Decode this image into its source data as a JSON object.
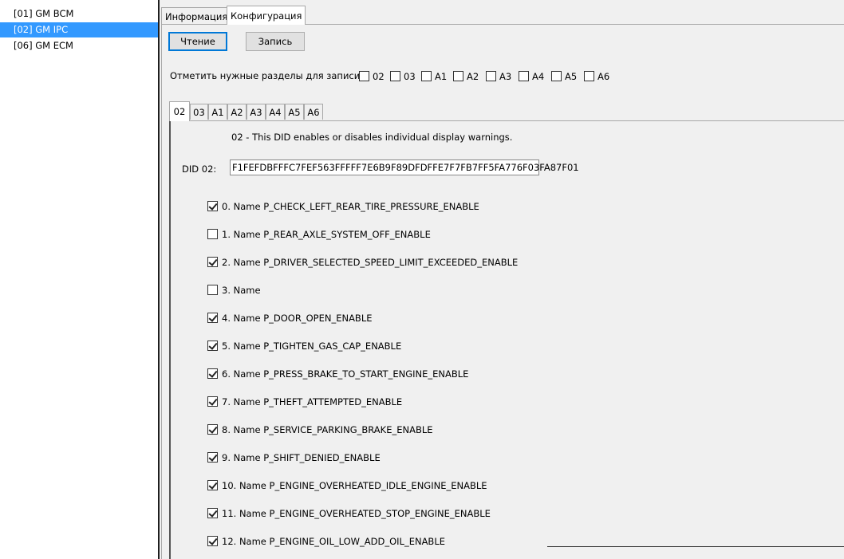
{
  "devices": [
    {
      "label": "[01] GM BCM",
      "selected": false
    },
    {
      "label": "[02] GM IPC",
      "selected": true
    },
    {
      "label": "[06] GM ECM",
      "selected": false
    }
  ],
  "top_tabs": [
    {
      "label": "Информация",
      "active": false
    },
    {
      "label": "Конфигурация",
      "active": true
    }
  ],
  "toolbar": {
    "read_label": "Чтение",
    "write_label": "Запись"
  },
  "sections": {
    "prompt": "Отметить нужные разделы для записи :",
    "items": [
      {
        "label": "02",
        "checked": false
      },
      {
        "label": "03",
        "checked": false
      },
      {
        "label": "A1",
        "checked": false
      },
      {
        "label": "A2",
        "checked": false
      },
      {
        "label": "A3",
        "checked": false
      },
      {
        "label": "A4",
        "checked": false
      },
      {
        "label": "A5",
        "checked": false
      },
      {
        "label": "A6",
        "checked": false
      }
    ]
  },
  "inner_tabs": [
    {
      "label": "02",
      "active": true
    },
    {
      "label": "03",
      "active": false
    },
    {
      "label": "A1",
      "active": false
    },
    {
      "label": "A2",
      "active": false
    },
    {
      "label": "A3",
      "active": false
    },
    {
      "label": "A4",
      "active": false
    },
    {
      "label": "A5",
      "active": false
    },
    {
      "label": "A6",
      "active": false
    }
  ],
  "did": {
    "description": "02 - This DID enables or disables individual display warnings.",
    "label": "DID 02:",
    "value": "F1FEFDBFFFC7FEF563FFFFF7E6B9F89DFDFFE7F7FB7FF5FA776F03FA87F01"
  },
  "options": [
    {
      "label": "0. Name P_CHECK_LEFT_REAR_TIRE_PRESSURE_ENABLE",
      "checked": true
    },
    {
      "label": "1. Name P_REAR_AXLE_SYSTEM_OFF_ENABLE",
      "checked": false
    },
    {
      "label": "2. Name P_DRIVER_SELECTED_SPEED_LIMIT_EXCEEDED_ENABLE",
      "checked": true
    },
    {
      "label": "3. Name",
      "checked": false
    },
    {
      "label": "4. Name P_DOOR_OPEN_ENABLE",
      "checked": true
    },
    {
      "label": "5. Name P_TIGHTEN_GAS_CAP_ENABLE",
      "checked": true
    },
    {
      "label": "6. Name P_PRESS_BRAKE_TO_START_ENGINE_ENABLE",
      "checked": true
    },
    {
      "label": "7. Name P_THEFT_ATTEMPTED_ENABLE",
      "checked": true
    },
    {
      "label": "8. Name P_SERVICE_PARKING_BRAKE_ENABLE",
      "checked": true
    },
    {
      "label": "9. Name P_SHIFT_DENIED_ENABLE",
      "checked": true
    },
    {
      "label": "10. Name P_ENGINE_OVERHEATED_IDLE_ENGINE_ENABLE",
      "checked": true
    },
    {
      "label": "11. Name P_ENGINE_OVERHEATED_STOP_ENGINE_ENABLE",
      "checked": true
    },
    {
      "label": "12. Name P_ENGINE_OIL_LOW_ADD_OIL_ENABLE",
      "checked": true
    }
  ]
}
